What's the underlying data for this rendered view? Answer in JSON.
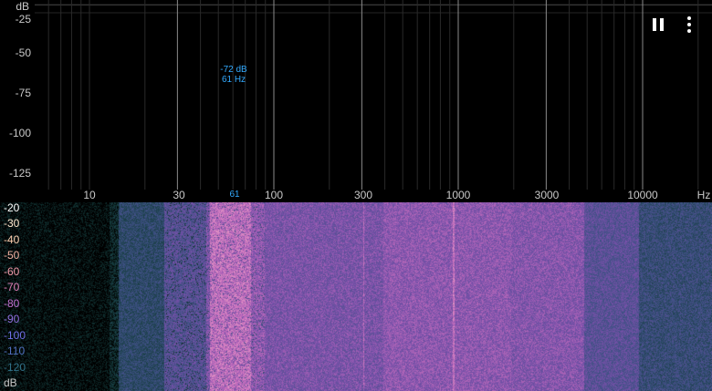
{
  "spectrum": {
    "y_unit": "dB",
    "y_ticks": [
      "-25",
      "-50",
      "-75",
      "-100",
      "-125"
    ],
    "x_ticks": [
      "10",
      "30",
      "100",
      "300",
      "1000",
      "3000",
      "10000"
    ],
    "x_unit": "Hz",
    "peak_db": "-72 dB",
    "peak_hz": "61 Hz",
    "peak_marker": "61",
    "colors": {
      "current": "#e0d000",
      "peak_hold": "#d0104a",
      "peak_label": "#33aaff",
      "grid": "#3a3a3a"
    }
  },
  "spectrogram": {
    "legend": [
      {
        "label": "-20",
        "color": "#ffffff"
      },
      {
        "label": "-30",
        "color": "#ffe9d0"
      },
      {
        "label": "-40",
        "color": "#ffd0b0"
      },
      {
        "label": "-50",
        "color": "#f0b0a0"
      },
      {
        "label": "-60",
        "color": "#f098a8"
      },
      {
        "label": "-70",
        "color": "#e080b8"
      },
      {
        "label": "-80",
        "color": "#c070d0"
      },
      {
        "label": "-90",
        "color": "#9070e0"
      },
      {
        "label": "-100",
        "color": "#7070e8"
      },
      {
        "label": "-110",
        "color": "#5070c0"
      },
      {
        "label": "-120",
        "color": "#307088"
      }
    ],
    "unit": "dB"
  },
  "controls": {
    "pause_icon": "pause-icon",
    "more_icon": "more-vertical-icon"
  }
}
